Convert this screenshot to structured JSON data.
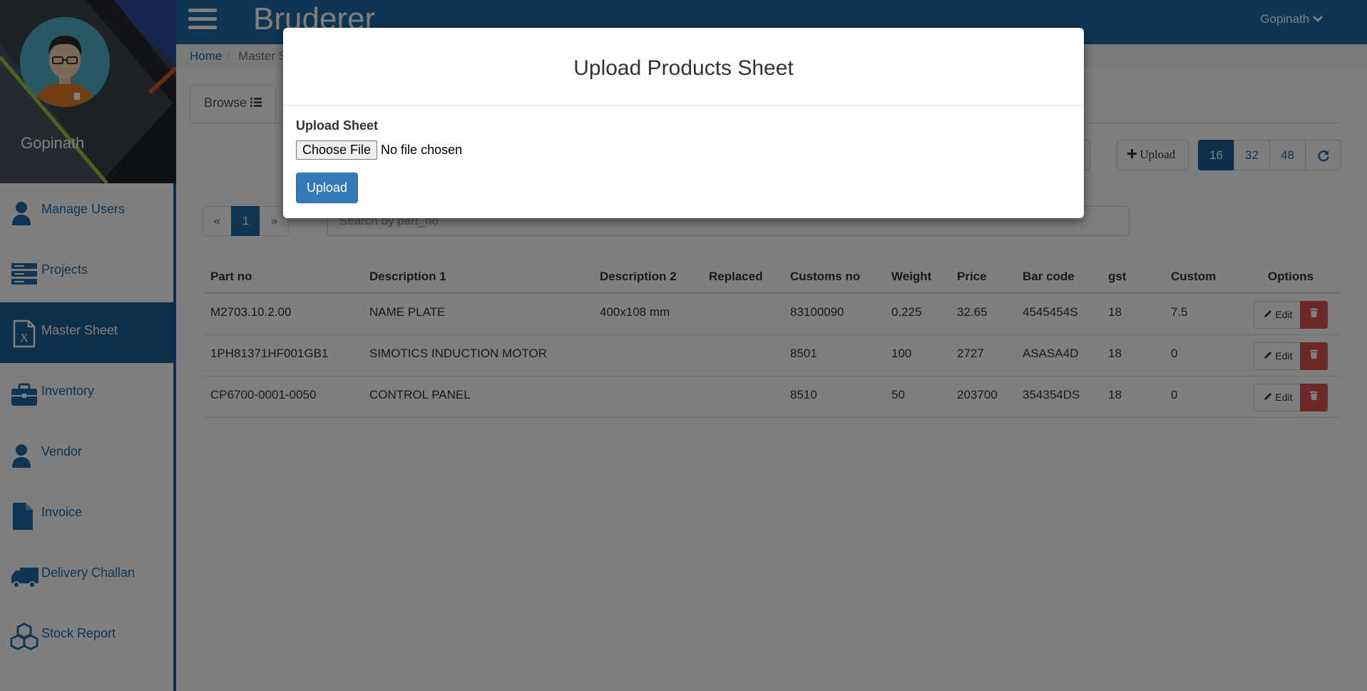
{
  "app": {
    "brand": "Bruderer",
    "user_menu": "Gopinath",
    "user_chevron": "chevron-down-icon"
  },
  "sidebar": {
    "profile_name": "Gopinath",
    "items": [
      {
        "label": "Manage Users",
        "icon": "user-icon",
        "active": false
      },
      {
        "label": "Projects",
        "icon": "server-icon",
        "active": false
      },
      {
        "label": "Master Sheet",
        "icon": "excel-file-icon",
        "active": true
      },
      {
        "label": "Inventory",
        "icon": "briefcase-icon",
        "active": false
      },
      {
        "label": "Vendor",
        "icon": "user-icon",
        "active": false
      },
      {
        "label": "Invoice",
        "icon": "file-icon",
        "active": false
      },
      {
        "label": "Delivery Challan",
        "icon": "truck-icon",
        "active": false
      },
      {
        "label": "Stock Report",
        "icon": "cubes-icon",
        "active": false
      }
    ]
  },
  "breadcrumb": {
    "home": "Home",
    "current": "Master S"
  },
  "tabs": {
    "browse": "Browse"
  },
  "toolbar": {
    "upload": "Upload",
    "page_sizes": [
      "16",
      "32",
      "48"
    ],
    "active_page_size": "16"
  },
  "pager": {
    "prev": "«",
    "current": "1",
    "next": "»"
  },
  "search": {
    "placeholder": "Search by part_no"
  },
  "table": {
    "headers": [
      "Part no",
      "Description 1",
      "Description 2",
      "Replaced",
      "Customs no",
      "Weight",
      "Price",
      "Bar code",
      "gst",
      "Custom",
      "Options"
    ],
    "rows": [
      [
        "M2703.10.2.00",
        "NAME PLATE",
        "400x108 mm",
        "",
        "83100090",
        "0.225",
        "32.65",
        "4545454S",
        "18",
        "7.5"
      ],
      [
        "1PH81371HF001GB1",
        "SIMOTICS INDUCTION MOTOR",
        "",
        "",
        "8501",
        "100",
        "2727",
        "ASASA4D",
        "18",
        "0"
      ],
      [
        "CP6700-0001-0050",
        "CONTROL PANEL",
        "",
        "",
        "8510",
        "50",
        "203700",
        "354354DS",
        "18",
        "0"
      ]
    ],
    "edit_label": "Edit"
  },
  "modal": {
    "title": "Upload Products Sheet",
    "field_label": "Upload Sheet",
    "choose_file": "Choose File",
    "file_status": "No file chosen",
    "submit": "Upload"
  },
  "colors": {
    "primary": "#1f6aa6",
    "active_nav": "#1a5f96",
    "danger": "#d9534f",
    "modal_button": "#337ab7"
  }
}
